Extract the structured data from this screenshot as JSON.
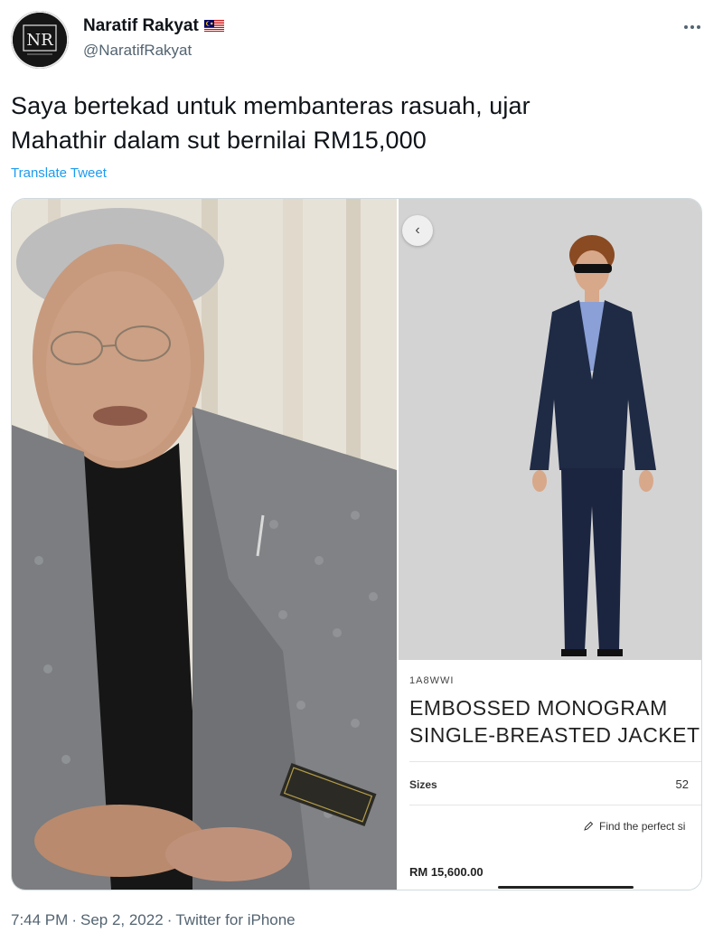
{
  "author": {
    "name": "Naratif Rakyat",
    "handle": "@NaratifRakyat",
    "avatar_initials": "NR",
    "flag": "malaysia-flag"
  },
  "tweet": {
    "text_line1": "Saya bertekad untuk membanteras rasuah, ujar",
    "text_line2": "Mahathir dalam sut bernilai RM15,000",
    "translate_label": "Translate Tweet"
  },
  "product": {
    "sku": "1A8WWI",
    "title_line1": "EMBOSSED MONOGRAM",
    "title_line2": "SINGLE-BREASTED JACKET",
    "sizes_label": "Sizes",
    "size_value": "52",
    "fit_label": "Find the perfect si",
    "price": "RM 15,600.00"
  },
  "footer": {
    "time": "7:44 PM",
    "date": "Sep 2, 2022",
    "client": "Twitter for iPhone",
    "sep": "·"
  },
  "colors": {
    "accent": "#1d9bf0",
    "secondary_text": "#536471",
    "border": "#cfd9de"
  }
}
